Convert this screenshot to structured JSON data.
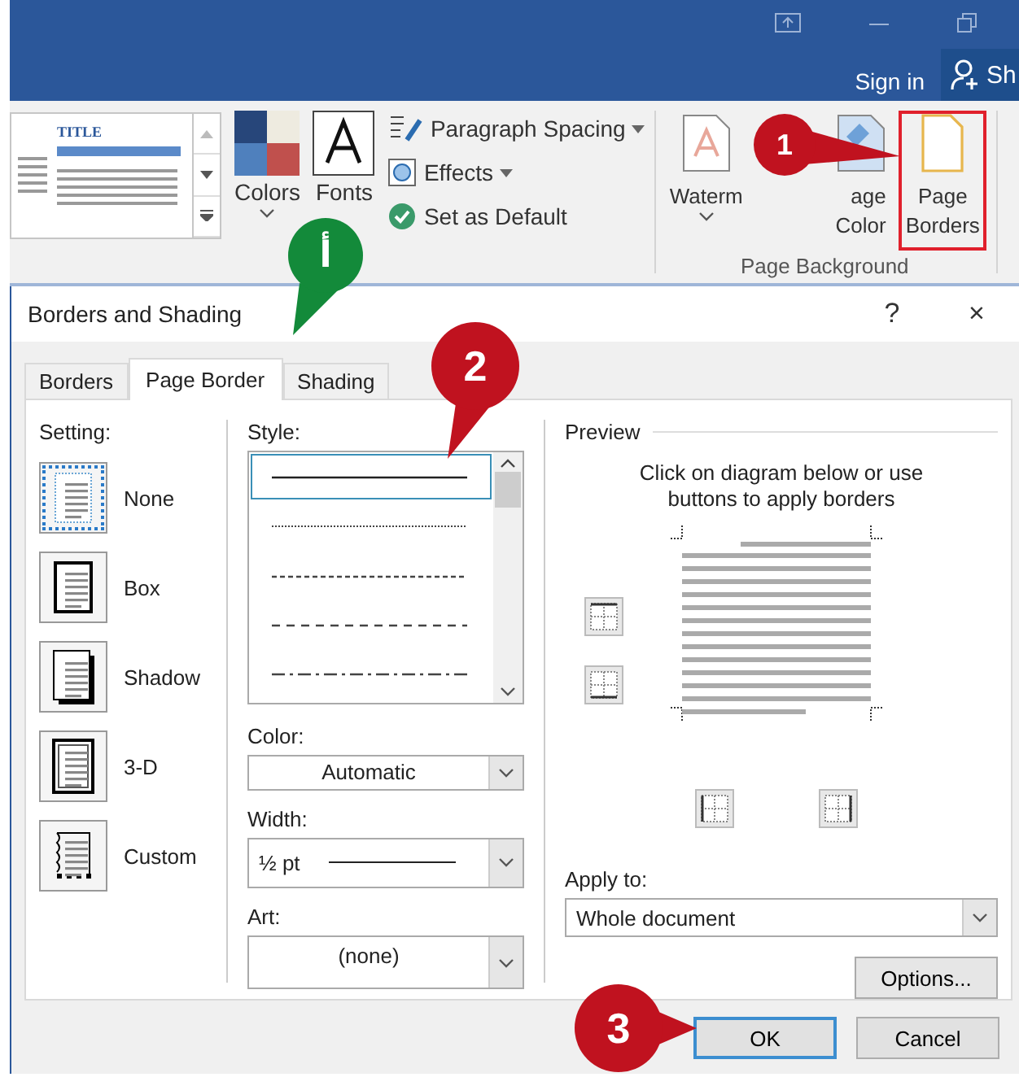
{
  "title_bar": {
    "sign_in": "Sign in",
    "share": "Sh"
  },
  "ribbon": {
    "theme_preview": {
      "title": "TITLE"
    },
    "colors": "Colors",
    "fonts": "Fonts",
    "commands": [
      {
        "kind": "spacing",
        "label": "Paragraph Spacing",
        "dropdown": true
      },
      {
        "kind": "effects",
        "label": "Effects",
        "dropdown": true
      },
      {
        "kind": "default",
        "label": "Set as Default",
        "dropdown": false
      }
    ],
    "page_background": {
      "label": "Page Background",
      "watermark": "Waterm",
      "page_color": [
        "age",
        "Color"
      ],
      "page_borders": [
        "Page",
        "Borders"
      ],
      "highlighted": true
    }
  },
  "dialog": {
    "title": "Borders and Shading",
    "help": "?",
    "close": "×",
    "tabs": [
      {
        "label": "Borders",
        "selected": false
      },
      {
        "label": "Page Border",
        "selected": true
      },
      {
        "label": "Shading",
        "selected": false
      }
    ],
    "setting": {
      "label": "Setting:",
      "items": [
        {
          "label": "None",
          "kind": "none",
          "selected": true
        },
        {
          "label": "Box",
          "kind": "box",
          "selected": false
        },
        {
          "label": "Shadow",
          "kind": "shadow",
          "selected": false
        },
        {
          "label": "3-D",
          "kind": "threed",
          "selected": false
        },
        {
          "label": "Custom",
          "kind": "custom",
          "selected": false
        }
      ]
    },
    "style": {
      "label": "Style:",
      "options": [
        {
          "kind": "solid",
          "selected": true
        },
        {
          "kind": "dotted",
          "selected": false
        },
        {
          "kind": "dashed",
          "selected": false
        },
        {
          "kind": "dashed-wide",
          "selected": false
        },
        {
          "kind": "dash-dot",
          "selected": false
        }
      ]
    },
    "color": {
      "label": "Color:",
      "value": "Automatic"
    },
    "width": {
      "label": "Width:",
      "value": "½ pt"
    },
    "art": {
      "label": "Art:",
      "value": "(none)"
    },
    "preview": {
      "label": "Preview",
      "hint": "Click on diagram below or use buttons to apply borders"
    },
    "apply_to": {
      "label": "Apply to:",
      "value": "Whole document"
    },
    "options_button": "Options...",
    "buttons": [
      {
        "label": "OK",
        "default": true
      },
      {
        "label": "Cancel",
        "default": false
      }
    ]
  },
  "callouts": [
    {
      "label": "1",
      "color": "#c0121f"
    },
    {
      "label": "أ",
      "color": "#138a3a"
    },
    {
      "label": "2",
      "color": "#c0121f"
    },
    {
      "label": "3",
      "color": "#c0121f"
    }
  ]
}
